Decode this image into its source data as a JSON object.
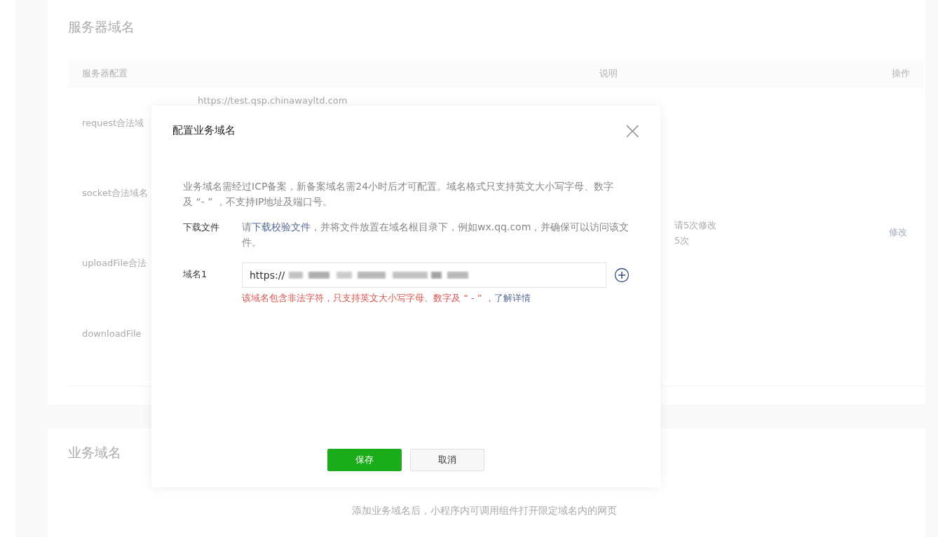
{
  "server_domain_section": {
    "title": "服务器域名",
    "table": {
      "columns": [
        "服务器配置",
        "说明",
        "操作"
      ],
      "rows": [
        {
          "name": "request合法域",
          "domains": [
            "https://test.qsp.chinawayltd.com"
          ]
        },
        {
          "name": "socket合法域名"
        },
        {
          "name": "uploadFile合法"
        },
        {
          "name": "downloadFile"
        }
      ],
      "description": [
        "请5次修改",
        "5次"
      ],
      "action": "修改"
    }
  },
  "business_domain_section": {
    "title": "业务域名",
    "description": "添加业务域名后，小程序内可调用组件打开限定域名内的网页"
  },
  "dialog": {
    "title": "配置业务域名",
    "close": "×",
    "notice": "业务域名需经过ICP备案，新备案域名需24小时后才可配置。域名格式只支持英文大小写字母、数字及 “- ” ，不支持IP地址及端口号。",
    "download_file": {
      "label": "下载文件",
      "text_before": "请",
      "link": "下载校验文件",
      "text_after": "，并将文件放置在域名根目录下，例如wx.qq.com，并确保可以访问该文件。"
    },
    "domain_fields": [
      {
        "label": "域名1",
        "value": "https://",
        "redacted": true,
        "error": "该域名包含非法字符，只支持英文大小写字母、数字及 “ - ” ，",
        "error_link": "了解详情"
      }
    ],
    "buttons": [
      {
        "label": "保存",
        "kind": "primary"
      },
      {
        "label": "取消",
        "kind": "default"
      }
    ]
  }
}
